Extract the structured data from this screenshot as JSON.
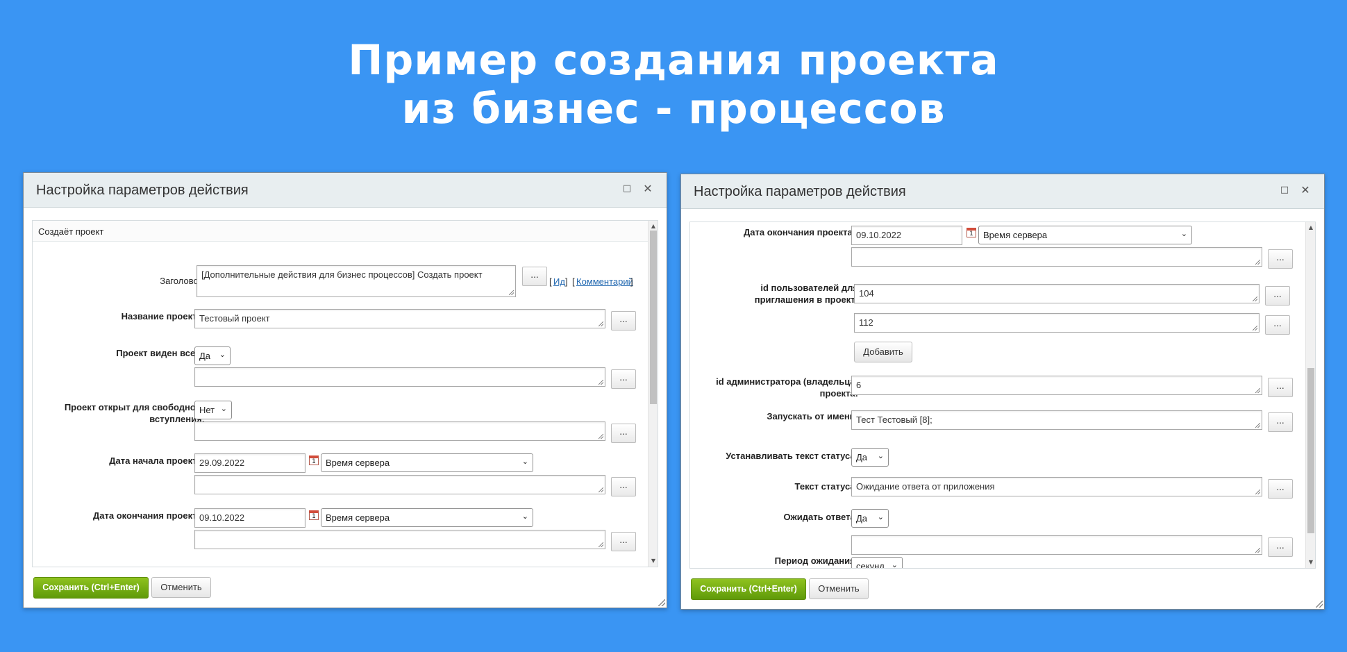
{
  "headline": {
    "line1": "Пример создания проекта",
    "line2": "из бизнес - процессов"
  },
  "left_dialog": {
    "title": "Настройка параметров действия",
    "section": "Создаёт проект",
    "fields": {
      "header_label": "Заголовок:",
      "header_value": "[Дополнительные действия для бизнес процессов] Создать проект",
      "id_link": "Ид",
      "comment_link": "Комментарий",
      "name_label": "Название проекта:",
      "name_value": "Тестовый проект",
      "visible_label": "Проект виден всем:",
      "visible_value": "Да",
      "open_label_1": "Проект открыт для свободного",
      "open_label_2": "вступления:",
      "open_value": "Нет",
      "start_label": "Дата начала проекта:",
      "start_value": "29.09.2022",
      "start_tz": "Время сервера",
      "end_label": "Дата окончания проекта:",
      "end_value": "09.10.2022",
      "end_tz": "Время сервера"
    },
    "save_label": "Сохранить (Ctrl+Enter)",
    "cancel_label": "Отменить"
  },
  "right_dialog": {
    "title": "Настройка параметров действия",
    "fields": {
      "end_label": "Дата окончания проекта:",
      "end_value": "09.10.2022",
      "end_tz": "Время сервера",
      "invite_label_1": "id пользователей для",
      "invite_label_2": "приглашения в проект:",
      "invite_value_1": "104",
      "invite_value_2": "112",
      "add_label": "Добавить",
      "admin_label_1": "id администратора (владельца)",
      "admin_label_2": "проекта:",
      "admin_value": "6",
      "runas_label": "Запускать от имени:",
      "runas_value": "Тест Тестовый [8];",
      "set_status_label": "Устанавливать текст статуса:",
      "set_status_value": "Да",
      "status_text_label": "Текст статуса:",
      "status_text_value": "Ожидание ответа от приложения",
      "wait_label": "Ожидать ответа:",
      "wait_value": "Да",
      "period_label": "Период ожидания:",
      "period_unit": "секунд"
    },
    "save_label": "Сохранить (Ctrl+Enter)",
    "cancel_label": "Отменить"
  },
  "icons": {
    "maximize": "□",
    "close": "✕",
    "chevron": "⌄",
    "calendar": "1",
    "dots": "..."
  }
}
